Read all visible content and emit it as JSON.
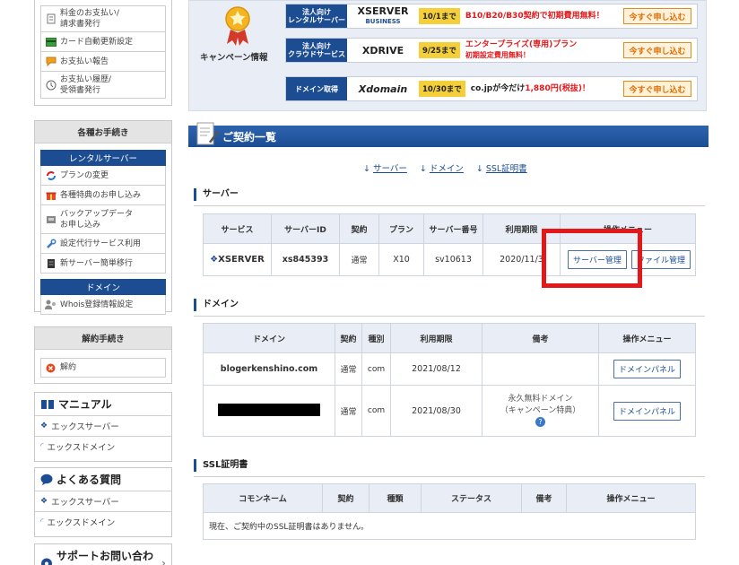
{
  "sidebar": {
    "top_items": [
      {
        "icon": "yen-doc-icon",
        "label": "料金のお支払い/\n請求書発行"
      },
      {
        "icon": "card-icon",
        "label": "カード自動更新設定"
      },
      {
        "icon": "report-icon",
        "label": "お支払い報告"
      },
      {
        "icon": "history-icon",
        "label": "お支払い履歴/\n受領書発行"
      }
    ],
    "procedures": {
      "title": "各種お手続き",
      "rental_server_label": "レンタルサーバー",
      "rental_items": [
        {
          "icon": "refresh-icon",
          "label": "プランの変更"
        },
        {
          "icon": "gift-icon",
          "label": "各種特典のお申し込み"
        },
        {
          "icon": "backup-icon",
          "label": "バックアップデータ\nお申し込み"
        },
        {
          "icon": "wrench-icon",
          "label": "設定代行サービス利用"
        },
        {
          "icon": "server-icon",
          "label": "新サーバー簡単移行"
        }
      ],
      "domain_label": "ドメイン",
      "domain_items": [
        {
          "icon": "user-icon",
          "label": "Whois登録情報設定"
        }
      ]
    },
    "cancel": {
      "title": "解約手続き",
      "item": "解約"
    },
    "manual": {
      "title": "マニュアル",
      "items": [
        "エックスサーバー",
        "エックスドメイン"
      ]
    },
    "faq": {
      "title": "よくある質問",
      "items": [
        "エックスサーバー",
        "エックスドメイン"
      ]
    },
    "support": {
      "title": "サポートお問い合わせ"
    }
  },
  "campaign": {
    "label": "キャンペーン情報",
    "rows": [
      {
        "tag": "法人向け\nレンタルサーバー",
        "logo": "XSERVER",
        "logo_sub": "BUSINESS",
        "date": "10/1まで",
        "text_red": "B10/B20/B30契約で初期費用無料！",
        "text_black": "",
        "text_red2": "",
        "button": "今すぐ申し込む"
      },
      {
        "tag": "法人向け\nクラウドサービス",
        "logo": "XDRIVE",
        "logo_sub": "",
        "date": "9/25まで",
        "text_red": "エンタープライズ(専用)プラン",
        "text_black": "",
        "text_red2": "初期設定費用無料！",
        "button": "今すぐ申し込む"
      },
      {
        "tag": "ドメイン取得",
        "logo": "Xdomain",
        "logo_sub": "",
        "date": "10/30まで",
        "text_red": "",
        "text_black": "co.jpが今だけ",
        "text_red2": "1,880円(税抜)！",
        "button": "今すぐ申し込む"
      }
    ]
  },
  "main": {
    "title": "ご契約一覧",
    "anchors": [
      "サーバー",
      "ドメイン",
      "SSL証明書"
    ],
    "server": {
      "heading": "サーバー",
      "columns": [
        "サービス",
        "サーバーID",
        "契約",
        "プラン",
        "サーバー番号",
        "利用期限",
        "操作メニュー"
      ],
      "row": {
        "service": "XSERVER",
        "id": "xs845393",
        "contract": "通常",
        "plan": "X10",
        "number": "sv10613",
        "expiry": "2020/11/3",
        "btn1": "サーバー管理",
        "btn2": "ファイル管理"
      }
    },
    "domain": {
      "heading": "ドメイン",
      "columns": [
        "ドメイン",
        "契約",
        "種別",
        "利用期限",
        "備考",
        "操作メニュー"
      ],
      "rows": [
        {
          "domain": "blogerkenshino.com",
          "contract": "通常",
          "type": "com",
          "expiry": "2021/08/12",
          "note": "",
          "btn": "ドメインパネル"
        },
        {
          "domain": "",
          "contract": "通常",
          "type": "com",
          "expiry": "2021/08/30",
          "note": "永久無料ドメイン\n（キャンペーン特典）",
          "btn": "ドメインパネル"
        }
      ]
    },
    "ssl": {
      "heading": "SSL証明書",
      "columns": [
        "コモンネーム",
        "契約",
        "種類",
        "ステータス",
        "備考",
        "操作メニュー"
      ],
      "empty": "現在、ご契約中のSSL証明書はありません。"
    }
  },
  "colors": {
    "navy": "#1c4d93",
    "highlight": "#e3181b",
    "orange": "#e36b00",
    "yellow": "#f4cf3a"
  }
}
